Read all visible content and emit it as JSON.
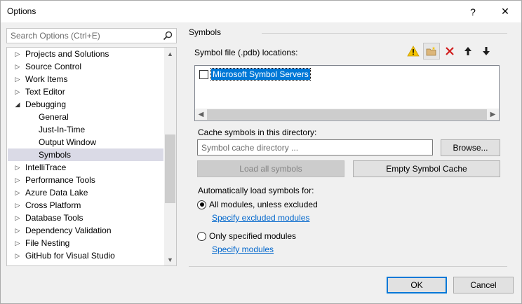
{
  "window": {
    "title": "Options",
    "help_glyph": "?",
    "close_glyph": "✕"
  },
  "search": {
    "placeholder": "Search Options (Ctrl+E)",
    "icon": "magnifier-icon"
  },
  "tree": {
    "items": [
      {
        "label": "Projects and Solutions",
        "level": 0,
        "state": "collapsed"
      },
      {
        "label": "Source Control",
        "level": 0,
        "state": "collapsed"
      },
      {
        "label": "Work Items",
        "level": 0,
        "state": "collapsed"
      },
      {
        "label": "Text Editor",
        "level": 0,
        "state": "collapsed"
      },
      {
        "label": "Debugging",
        "level": 0,
        "state": "expanded"
      },
      {
        "label": "General",
        "level": 1,
        "state": "leaf"
      },
      {
        "label": "Just-In-Time",
        "level": 1,
        "state": "leaf"
      },
      {
        "label": "Output Window",
        "level": 1,
        "state": "leaf"
      },
      {
        "label": "Symbols",
        "level": 1,
        "state": "leaf",
        "selected": true
      },
      {
        "label": "IntelliTrace",
        "level": 0,
        "state": "collapsed"
      },
      {
        "label": "Performance Tools",
        "level": 0,
        "state": "collapsed"
      },
      {
        "label": "Azure Data Lake",
        "level": 0,
        "state": "collapsed"
      },
      {
        "label": "Cross Platform",
        "level": 0,
        "state": "collapsed"
      },
      {
        "label": "Database Tools",
        "level": 0,
        "state": "collapsed"
      },
      {
        "label": "Dependency Validation",
        "level": 0,
        "state": "collapsed"
      },
      {
        "label": "File Nesting",
        "level": 0,
        "state": "collapsed"
      },
      {
        "label": "GitHub for Visual Studio",
        "level": 0,
        "state": "collapsed"
      }
    ]
  },
  "symbols": {
    "section_title": "Symbols",
    "locations_label": "Symbol file (.pdb) locations:",
    "locations": [
      {
        "label": "Microsoft Symbol Servers",
        "checked": false,
        "selected": true
      }
    ],
    "toolbar_icons": [
      "warning-icon",
      "new-folder-icon",
      "delete-icon",
      "move-up-icon",
      "move-down-icon"
    ],
    "cache_label": "Cache symbols in this directory:",
    "cache_placeholder": "Symbol cache directory ...",
    "browse_label": "Browse...",
    "load_all_label": "Load all symbols",
    "empty_cache_label": "Empty Symbol Cache",
    "auto_load_label": "Automatically load symbols for:",
    "option_all": "All modules, unless excluded",
    "link_excluded": "Specify excluded modules",
    "option_only": "Only specified modules",
    "link_modules": "Specify modules",
    "selected_option": "all"
  },
  "footer": {
    "ok_label": "OK",
    "cancel_label": "Cancel"
  },
  "colors": {
    "selection": "#0078d7",
    "tree_selection": "#dadae6",
    "link": "#0066cc",
    "warning": "#f5c400",
    "delete": "#d01c1c"
  }
}
